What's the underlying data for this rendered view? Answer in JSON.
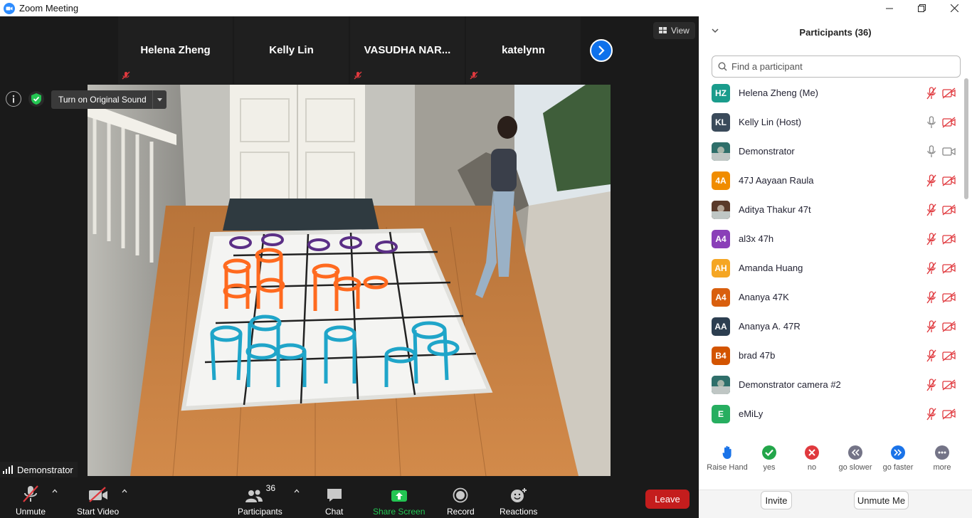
{
  "window": {
    "title": "Zoom Meeting"
  },
  "thumbnails": [
    {
      "name": "Helena Zheng",
      "muted": true
    },
    {
      "name": "Kelly Lin",
      "muted": false
    },
    {
      "name": "VASUDHA  NAR...",
      "muted": true
    },
    {
      "name": "katelynn",
      "muted": true
    }
  ],
  "view_button": {
    "label": "View"
  },
  "original_sound": {
    "label": "Turn on Original Sound"
  },
  "active_speaker": {
    "name": "Demonstrator"
  },
  "toolbar": {
    "unmute": "Unmute",
    "start_video": "Start Video",
    "participants": "Participants",
    "participant_count": "36",
    "chat": "Chat",
    "share_screen": "Share Screen",
    "record": "Record",
    "reactions": "Reactions",
    "leave": "Leave"
  },
  "panel": {
    "title": "Participants (36)",
    "search_placeholder": "Find a participant",
    "participants": [
      {
        "initials": "HZ",
        "name": "Helena Zheng (Me)",
        "color": "#1a9c8c",
        "mic": "muted",
        "cam": "off"
      },
      {
        "initials": "KL",
        "name": "Kelly Lin (Host)",
        "color": "#3a4a5a",
        "mic": "on",
        "cam": "off"
      },
      {
        "initials": "",
        "name": "Demonstrator",
        "color": "#2f6f6a",
        "mic": "on",
        "cam": "on",
        "photo": true
      },
      {
        "initials": "4A",
        "name": "47J Aayaan Raula",
        "color": "#f08c00",
        "mic": "muted",
        "cam": "off"
      },
      {
        "initials": "",
        "name": "Aditya Thakur 47t",
        "color": "#5a3a2a",
        "mic": "muted",
        "cam": "off",
        "photo": true
      },
      {
        "initials": "A4",
        "name": "al3x 47h",
        "color": "#8a3fb8",
        "mic": "muted",
        "cam": "off"
      },
      {
        "initials": "AH",
        "name": "Amanda Huang",
        "color": "#f5a623",
        "mic": "muted",
        "cam": "off"
      },
      {
        "initials": "A4",
        "name": "Ananya 47K",
        "color": "#d95f0e",
        "mic": "muted",
        "cam": "off"
      },
      {
        "initials": "AA",
        "name": "Ananya A. 47R",
        "color": "#2c3e50",
        "mic": "muted",
        "cam": "off"
      },
      {
        "initials": "B4",
        "name": "brad 47b",
        "color": "#d35400",
        "mic": "muted",
        "cam": "off"
      },
      {
        "initials": "",
        "name": "Demonstrator camera #2",
        "color": "#2f6f6a",
        "mic": "muted",
        "cam": "off",
        "photo": true
      },
      {
        "initials": "E",
        "name": "eMiLy",
        "color": "#27ae60",
        "mic": "muted",
        "cam": "off"
      }
    ],
    "reactions": [
      {
        "label": "Raise Hand",
        "icon": "raise-hand-icon"
      },
      {
        "label": "yes",
        "icon": "check-icon",
        "color": "#23a64a"
      },
      {
        "label": "no",
        "icon": "x-icon",
        "color": "#e0393e"
      },
      {
        "label": "go slower",
        "icon": "rewind-icon",
        "color": "#747487"
      },
      {
        "label": "go faster",
        "icon": "fast-forward-icon",
        "color": "#1a73e8"
      },
      {
        "label": "more",
        "icon": "more-icon",
        "color": "#747487"
      }
    ],
    "invite": "Invite",
    "unmute_me": "Unmute Me"
  }
}
